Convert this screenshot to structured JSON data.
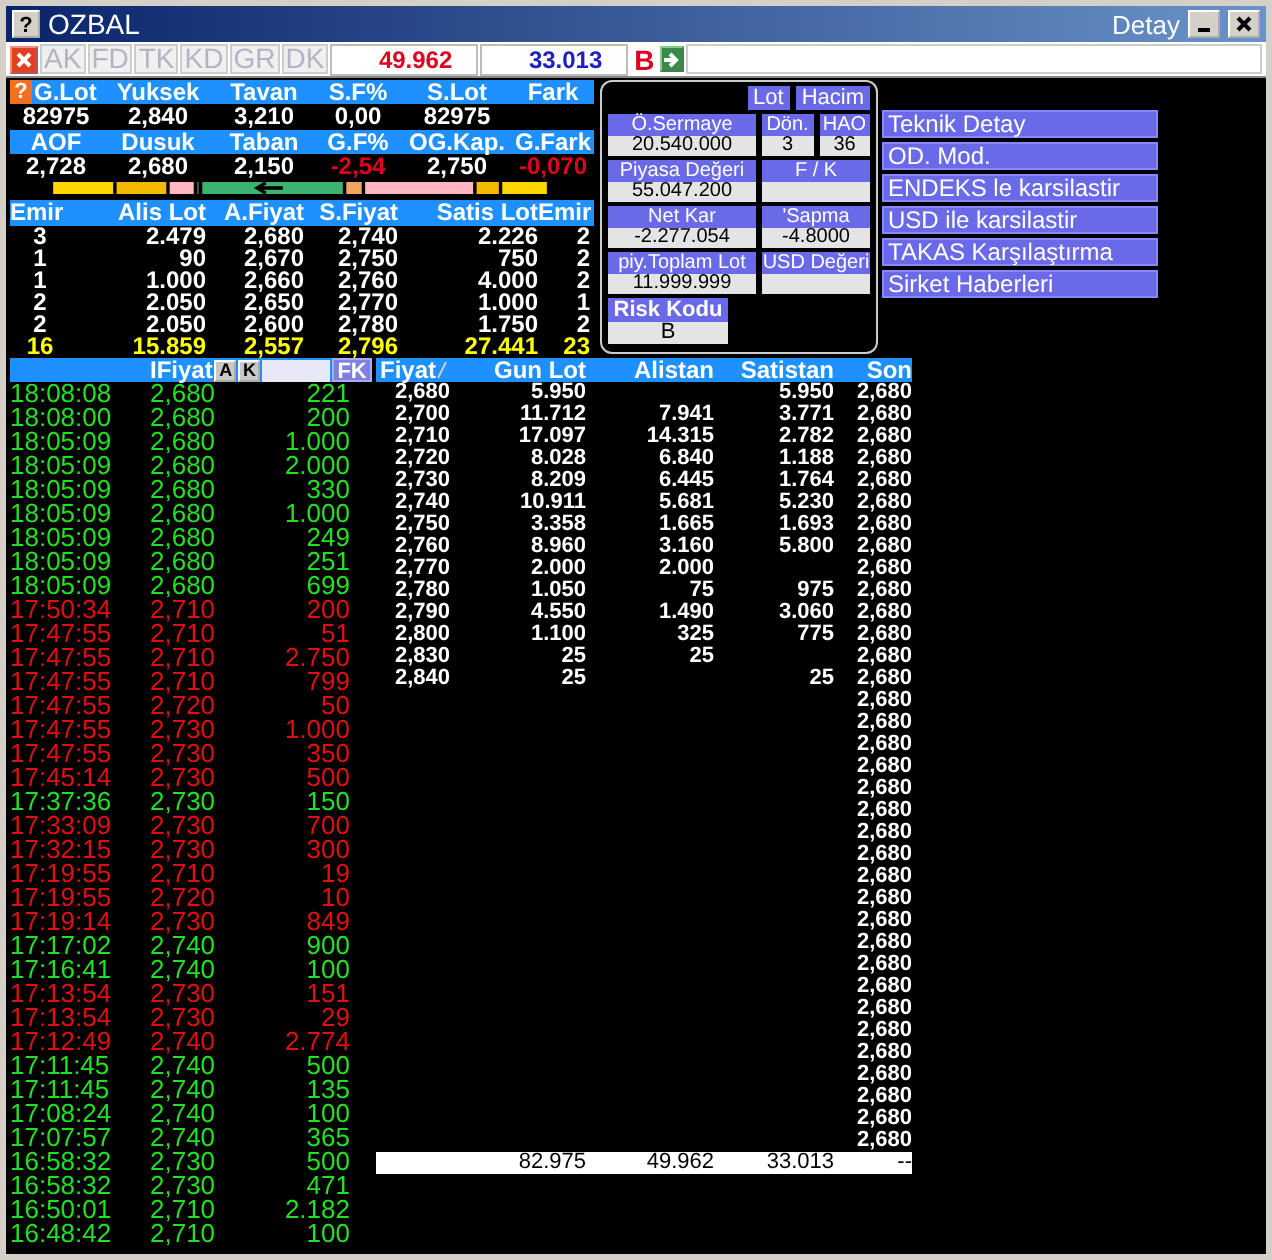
{
  "window": {
    "icon_label": "?",
    "title": "OZBAL",
    "subtitle": "Detay"
  },
  "toolbar": {
    "tabs": [
      {
        "label": "AK",
        "disabled": true
      },
      {
        "label": "FD",
        "disabled": true
      },
      {
        "label": "TK",
        "disabled": true
      },
      {
        "label": "KD",
        "disabled": true
      },
      {
        "label": "GR",
        "disabled": true
      },
      {
        "label": "DK",
        "disabled": true
      }
    ],
    "bid_total": "49.962",
    "ask_total": "33.013",
    "mode": "B"
  },
  "stats": {
    "help_label": "?",
    "rows": [
      {
        "cells": [
          {
            "label": "G.Lot",
            "value": "82975",
            "negative": false
          },
          {
            "label": "Yuksek",
            "value": "2,840",
            "negative": false
          },
          {
            "label": "Tavan",
            "value": "3,210",
            "negative": false
          },
          {
            "label": "S.F%",
            "value": "0,00",
            "negative": false
          },
          {
            "label": "S.Lot",
            "value": "82975",
            "negative": false
          },
          {
            "label": "Fark"
          }
        ]
      },
      {
        "cells": [
          {
            "label": "AOF",
            "value": "2,728",
            "negative": false
          },
          {
            "label": "Dusuk",
            "value": "2,680",
            "negative": false
          },
          {
            "label": "Taban",
            "value": "2,150",
            "negative": false
          },
          {
            "label": "G.F%",
            "value": "-2,54",
            "negative": true
          },
          {
            "label": "OG.Kap.",
            "value": "2,750",
            "negative": false
          },
          {
            "label": "G.Fark",
            "value": "-0,070",
            "negative": true
          }
        ]
      }
    ]
  },
  "depth": {
    "columns": [
      "Emir",
      "Alis Lot",
      "A.Fiyat",
      "S.Fiyat",
      "Satis Lot",
      "Emir"
    ],
    "rows": [
      [
        "3",
        "2.479",
        "2,680",
        "2,740",
        "2.226",
        "2"
      ],
      [
        "1",
        "90",
        "2,670",
        "2,750",
        "750",
        "2"
      ],
      [
        "1",
        "1.000",
        "2,660",
        "2,760",
        "4.000",
        "2"
      ],
      [
        "2",
        "2.050",
        "2,650",
        "2,770",
        "1.000",
        "1"
      ],
      [
        "2",
        "2.050",
        "2,600",
        "2,780",
        "1.750",
        "2"
      ]
    ],
    "totals": [
      "16",
      "15.859",
      "2,557",
      "2,796",
      "27.441",
      "23"
    ]
  },
  "info_panel": {
    "units": [
      {
        "label": "Lot",
        "selected": false
      },
      {
        "label": "Hacim",
        "selected": false
      }
    ],
    "field_rows": [
      [
        {
          "label": "Ö.Sermaye",
          "value": "20.540.000"
        },
        {
          "label": "Dön.",
          "value": "3"
        },
        {
          "label": "HAO",
          "value": "36"
        }
      ],
      [
        {
          "label": "Piyasa Değeri",
          "value": "55.047.200"
        },
        {
          "label": "F / K"
        }
      ],
      [
        {
          "label": "Net Kar",
          "value": "-2.277.054"
        },
        {
          "label": "'Sapma",
          "value": "-4.8000"
        }
      ],
      [
        {
          "label": "piy.Toplam Lot",
          "value": "11.999.999"
        },
        {
          "label": "USD Değeri"
        }
      ]
    ],
    "risk": {
      "label": "Risk Kodu",
      "value": "B"
    }
  },
  "actions": [
    "Teknik Detay",
    "OD. Mod.",
    "ENDEKS le karsilastir",
    "USD ile karsilastir",
    "TAKAS Karşılaştırma",
    "Sirket Haberleri"
  ],
  "trades": {
    "header": "IFiyat",
    "buttons": [
      "A",
      "K"
    ],
    "filter_button": "FK",
    "rows": [
      {
        "time": "18:08:08",
        "price": "2,680",
        "lot": "221",
        "rising": true
      },
      {
        "time": "18:08:00",
        "price": "2,680",
        "lot": "200",
        "rising": true
      },
      {
        "time": "18:05:09",
        "price": "2,680",
        "lot": "1.000",
        "rising": true
      },
      {
        "time": "18:05:09",
        "price": "2,680",
        "lot": "2.000",
        "rising": true
      },
      {
        "time": "18:05:09",
        "price": "2,680",
        "lot": "330",
        "rising": true
      },
      {
        "time": "18:05:09",
        "price": "2,680",
        "lot": "1.000",
        "rising": true
      },
      {
        "time": "18:05:09",
        "price": "2,680",
        "lot": "249",
        "rising": true
      },
      {
        "time": "18:05:09",
        "price": "2,680",
        "lot": "251",
        "rising": true
      },
      {
        "time": "18:05:09",
        "price": "2,680",
        "lot": "699",
        "rising": true
      },
      {
        "time": "17:50:34",
        "price": "2,710",
        "lot": "200",
        "rising": false
      },
      {
        "time": "17:47:55",
        "price": "2,710",
        "lot": "51",
        "rising": false
      },
      {
        "time": "17:47:55",
        "price": "2,710",
        "lot": "2.750",
        "rising": false
      },
      {
        "time": "17:47:55",
        "price": "2,710",
        "lot": "799",
        "rising": false
      },
      {
        "time": "17:47:55",
        "price": "2,720",
        "lot": "50",
        "rising": false
      },
      {
        "time": "17:47:55",
        "price": "2,730",
        "lot": "1.000",
        "rising": false
      },
      {
        "time": "17:47:55",
        "price": "2,730",
        "lot": "350",
        "rising": false
      },
      {
        "time": "17:45:14",
        "price": "2,730",
        "lot": "500",
        "rising": false
      },
      {
        "time": "17:37:36",
        "price": "2,730",
        "lot": "150",
        "rising": true
      },
      {
        "time": "17:33:09",
        "price": "2,730",
        "lot": "700",
        "rising": false
      },
      {
        "time": "17:32:15",
        "price": "2,730",
        "lot": "300",
        "rising": false
      },
      {
        "time": "17:19:55",
        "price": "2,710",
        "lot": "19",
        "rising": false
      },
      {
        "time": "17:19:55",
        "price": "2,720",
        "lot": "10",
        "rising": false
      },
      {
        "time": "17:19:14",
        "price": "2,730",
        "lot": "849",
        "rising": false
      },
      {
        "time": "17:17:02",
        "price": "2,740",
        "lot": "900",
        "rising": true
      },
      {
        "time": "17:16:41",
        "price": "2,740",
        "lot": "100",
        "rising": true
      },
      {
        "time": "17:13:54",
        "price": "2,730",
        "lot": "151",
        "rising": false
      },
      {
        "time": "17:13:54",
        "price": "2,730",
        "lot": "29",
        "rising": false
      },
      {
        "time": "17:12:49",
        "price": "2,740",
        "lot": "2.774",
        "rising": false
      },
      {
        "time": "17:11:45",
        "price": "2,740",
        "lot": "500",
        "rising": true
      },
      {
        "time": "17:11:45",
        "price": "2,740",
        "lot": "135",
        "rising": true
      },
      {
        "time": "17:08:24",
        "price": "2,740",
        "lot": "100",
        "rising": true
      },
      {
        "time": "17:07:57",
        "price": "2,740",
        "lot": "365",
        "rising": true
      },
      {
        "time": "16:58:32",
        "price": "2,730",
        "lot": "500",
        "rising": true
      },
      {
        "time": "16:58:32",
        "price": "2,730",
        "lot": "471",
        "rising": true
      },
      {
        "time": "16:50:01",
        "price": "2,710",
        "lot": "2.182",
        "rising": true
      },
      {
        "time": "16:48:42",
        "price": "2,710",
        "lot": "100",
        "rising": true
      }
    ]
  },
  "price_table": {
    "columns": [
      "Fiyat",
      "Gun Lot",
      "Alistan",
      "Satistan",
      "Son"
    ],
    "rows": [
      {
        "price": "2,680",
        "gun_lot": "5.950",
        "satistan": "5.950",
        "son": "2,680"
      },
      {
        "price": "2,700",
        "gun_lot": "11.712",
        "alistan": "7.941",
        "satistan": "3.771",
        "son": "2,680"
      },
      {
        "price": "2,710",
        "gun_lot": "17.097",
        "alistan": "14.315",
        "satistan": "2.782",
        "son": "2,680"
      },
      {
        "price": "2,720",
        "gun_lot": "8.028",
        "alistan": "6.840",
        "satistan": "1.188",
        "son": "2,680"
      },
      {
        "price": "2,730",
        "gun_lot": "8.209",
        "alistan": "6.445",
        "satistan": "1.764",
        "son": "2,680"
      },
      {
        "price": "2,740",
        "gun_lot": "10.911",
        "alistan": "5.681",
        "satistan": "5.230",
        "son": "2,680"
      },
      {
        "price": "2,750",
        "gun_lot": "3.358",
        "alistan": "1.665",
        "satistan": "1.693",
        "son": "2,680"
      },
      {
        "price": "2,760",
        "gun_lot": "8.960",
        "alistan": "3.160",
        "satistan": "5.800",
        "son": "2,680"
      },
      {
        "price": "2,770",
        "gun_lot": "2.000",
        "alistan": "2.000",
        "son": "2,680"
      },
      {
        "price": "2,780",
        "gun_lot": "1.050",
        "alistan": "75",
        "satistan": "975",
        "son": "2,680"
      },
      {
        "price": "2,790",
        "gun_lot": "4.550",
        "alistan": "1.490",
        "satistan": "3.060",
        "son": "2,680"
      },
      {
        "price": "2,800",
        "gun_lot": "1.100",
        "alistan": "325",
        "satistan": "775",
        "son": "2,680"
      },
      {
        "price": "2,830",
        "gun_lot": "25",
        "alistan": "25",
        "son": "2,680"
      },
      {
        "price": "2,840",
        "gun_lot": "25",
        "satistan": "25",
        "son": "2,680"
      },
      {
        "son": "2,680"
      },
      {
        "son": "2,680"
      },
      {
        "son": "2,680"
      },
      {
        "son": "2,680"
      },
      {
        "son": "2,680"
      },
      {
        "son": "2,680"
      },
      {
        "son": "2,680"
      },
      {
        "son": "2,680"
      },
      {
        "son": "2,680"
      },
      {
        "son": "2,680"
      },
      {
        "son": "2,680"
      },
      {
        "son": "2,680"
      },
      {
        "son": "2,680"
      },
      {
        "son": "2,680"
      },
      {
        "son": "2,680"
      },
      {
        "son": "2,680"
      },
      {
        "son": "2,680"
      },
      {
        "son": "2,680"
      },
      {
        "son": "2,680"
      },
      {
        "son": "2,680"
      },
      {
        "son": "2,680"
      }
    ],
    "totals": {
      "gun_lot": "82.975",
      "alistan": "49.962",
      "satistan": "33.013",
      "son": "--"
    }
  }
}
